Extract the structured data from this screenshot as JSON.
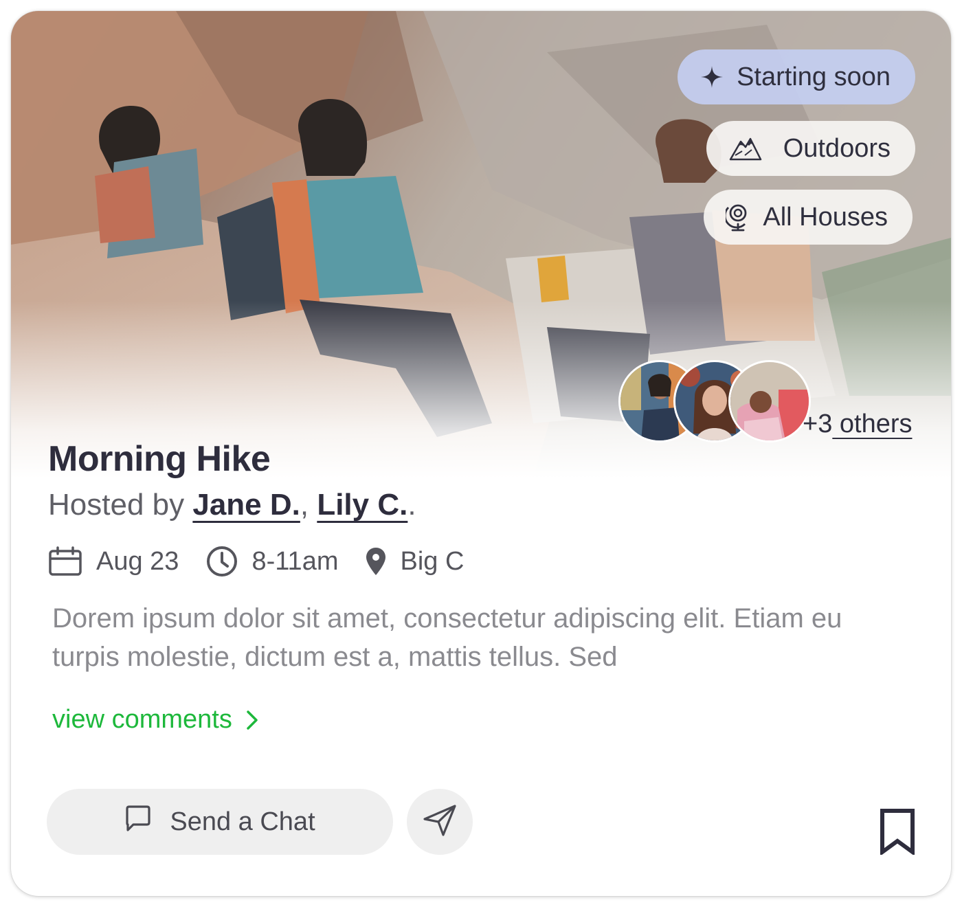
{
  "event": {
    "title": "Morning Hike",
    "hosted_prefix": "Hosted by ",
    "hosts": [
      "Jane D.",
      "Lily C."
    ],
    "host_separator": ", ",
    "host_suffix": ".",
    "date": "Aug 23",
    "time": "8-11am",
    "location": "Big C",
    "description": "Dorem ipsum dolor sit amet, consectetur adipiscing elit. Etiam eu turpis molestie, dictum est a, mattis tellus. Sed"
  },
  "tags": {
    "status": "Starting soon",
    "category": "Outdoors",
    "audience": "All Houses"
  },
  "attendees": {
    "count_prefix": "+3",
    "others_label": " others",
    "avatar_count": 3
  },
  "actions": {
    "comments_label": "view comments",
    "chat_label": "Send a Chat"
  },
  "icons": {
    "status": "sparkle-icon",
    "category": "mountain-icon",
    "audience": "globe-icon",
    "date": "calendar-icon",
    "time": "clock-icon",
    "location": "map-pin-icon",
    "comments": "chevron-right-icon",
    "chat": "chat-bubble-icon",
    "share": "send-icon",
    "save": "bookmark-icon"
  },
  "colors": {
    "title": "#2e2d3d",
    "accent_green": "#1db83b",
    "status_tag_bg": "#c4cdf0",
    "button_bg": "#efefef",
    "muted_text": "#8a8a8f"
  }
}
